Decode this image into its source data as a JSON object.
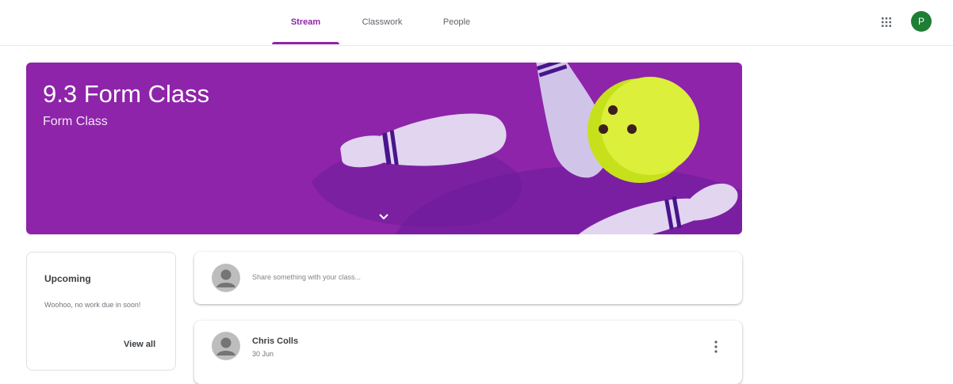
{
  "nav": {
    "tabs": [
      {
        "label": "Stream",
        "active": true
      },
      {
        "label": "Classwork",
        "active": false
      },
      {
        "label": "People",
        "active": false
      }
    ],
    "apps_icon": "apps-grid-icon",
    "account_initial": "P"
  },
  "banner": {
    "title": "9.3 Form Class",
    "subtitle": "Form Class",
    "color": "#8e24aa",
    "illustration": "bowling-pins-and-ball",
    "expand_icon": "chevron-down-icon"
  },
  "upcoming": {
    "title": "Upcoming",
    "message": "Woohoo, no work due in soon!",
    "view_all_label": "View all"
  },
  "share": {
    "placeholder": "Share something with your class..."
  },
  "post": {
    "author": "Chris Colls",
    "date": "30 Jun"
  },
  "colors": {
    "accent": "#8e24aa",
    "account_avatar": "#1e7e34"
  }
}
